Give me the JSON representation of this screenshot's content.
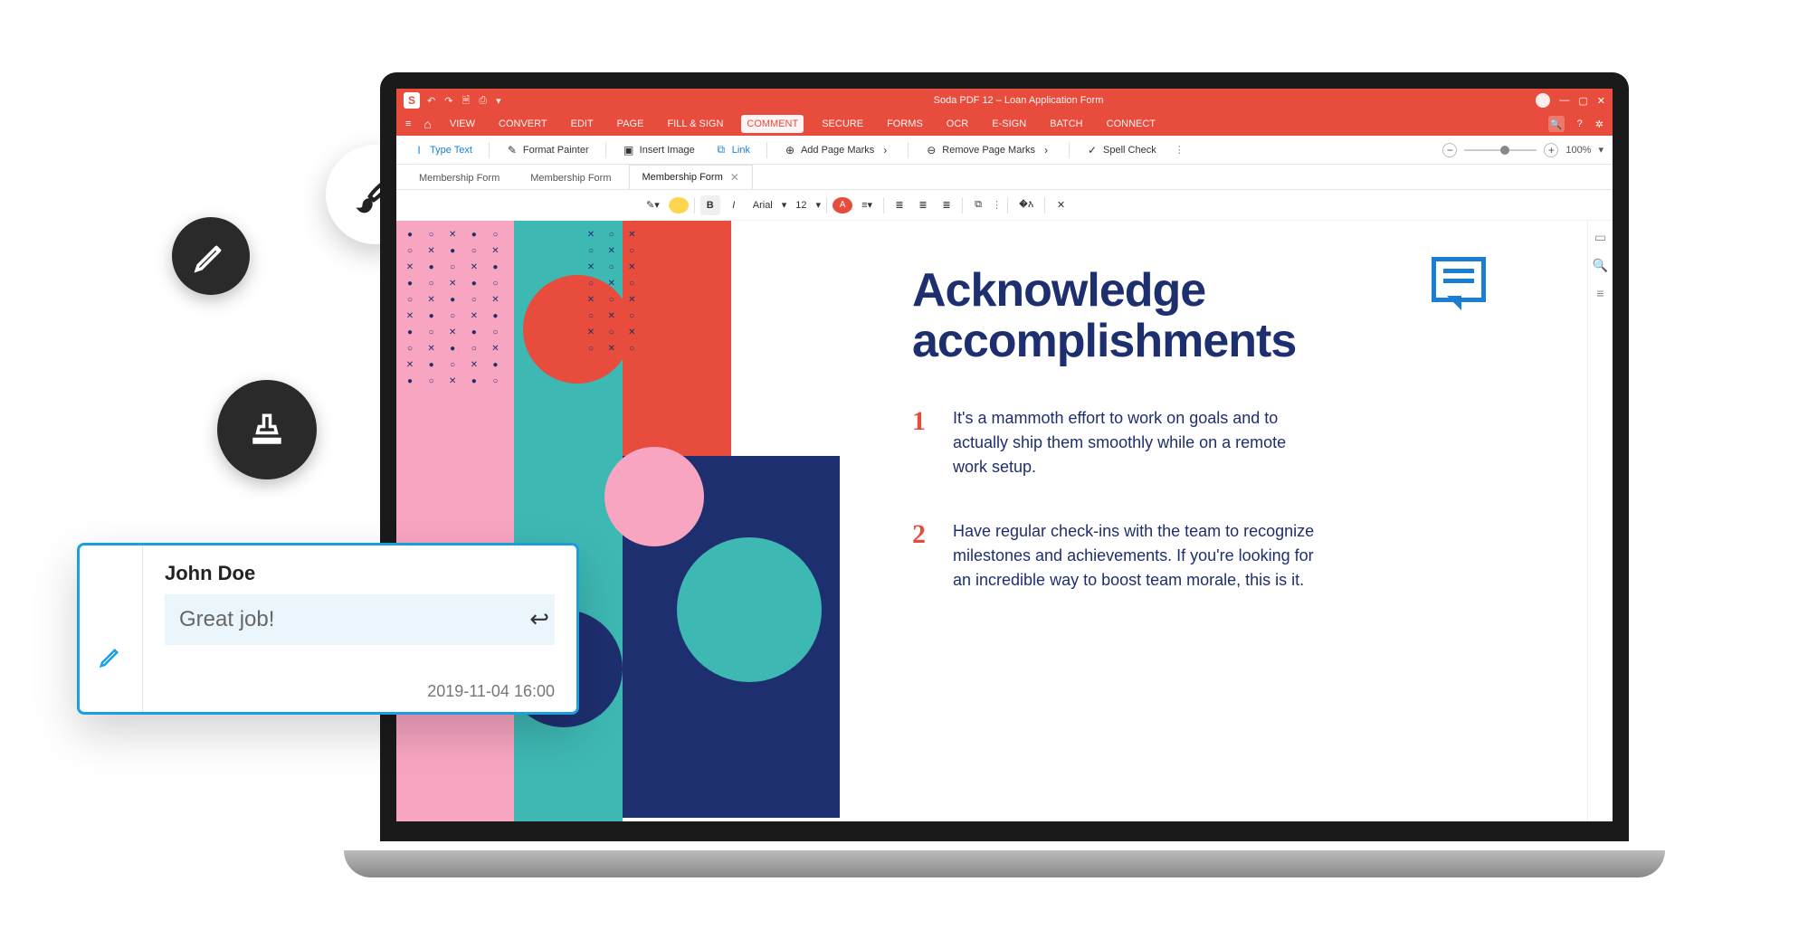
{
  "window": {
    "app_name": "Soda PDF 12",
    "doc_name": "Loan Application Form",
    "title": "Soda PDF 12  –  Loan Application Form"
  },
  "menu": {
    "items": [
      "VIEW",
      "CONVERT",
      "EDIT",
      "PAGE",
      "FILL & SIGN",
      "COMMENT",
      "SECURE",
      "FORMS",
      "OCR",
      "E-SIGN",
      "BATCH",
      "CONNECT"
    ],
    "active": "COMMENT"
  },
  "toolbar": {
    "type_text": "Type Text",
    "format_painter": "Format Painter",
    "insert_image": "Insert Image",
    "link": "Link",
    "add_page_marks": "Add Page Marks",
    "remove_page_marks": "Remove Page Marks",
    "spell_check": "Spell Check"
  },
  "zoom": {
    "value": "100%"
  },
  "tabs": [
    {
      "label": "Membership Form",
      "active": false
    },
    {
      "label": "Membership Form",
      "active": false
    },
    {
      "label": "Membership Form",
      "active": true
    }
  ],
  "format": {
    "font": "Arial",
    "size": "12"
  },
  "document": {
    "headline_line1": "Acknowledge",
    "headline_line2": "accomplishments",
    "items": [
      {
        "num": "1",
        "text": "It's a mammoth effort to work on goals and to actually ship them smoothly while on a remote work setup."
      },
      {
        "num": "2",
        "text": "Have regular check-ins with the team to recognize milestones and achievements. If you're looking for an incredible way to boost team morale, this is it."
      }
    ]
  },
  "comment": {
    "author": "John Doe",
    "message": "Great job!",
    "timestamp": "2019-11-04  16:00"
  },
  "colors": {
    "brand_red": "#e74c3c",
    "brand_navy": "#1e2f6f",
    "brand_teal": "#3eb8b3",
    "link_blue": "#1a7fd4"
  }
}
